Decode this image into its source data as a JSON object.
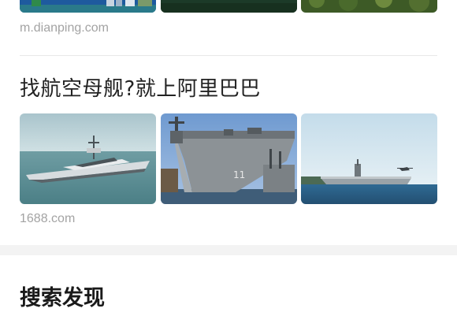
{
  "top_result": {
    "source": "m.dianping.com",
    "images": [
      {
        "name": "city-waterfront-thumb"
      },
      {
        "name": "dark-water-thumb"
      },
      {
        "name": "green-trees-thumb"
      }
    ]
  },
  "alibaba_result": {
    "title": "找航空母舰?就上阿里巴巴",
    "source": "1688.com",
    "images": [
      {
        "name": "luxury-yacht-thumb"
      },
      {
        "name": "aircraft-carrier-docked-thumb"
      },
      {
        "name": "aircraft-carrier-at-sea-thumb"
      }
    ]
  },
  "discover": {
    "title": "搜索发现"
  }
}
